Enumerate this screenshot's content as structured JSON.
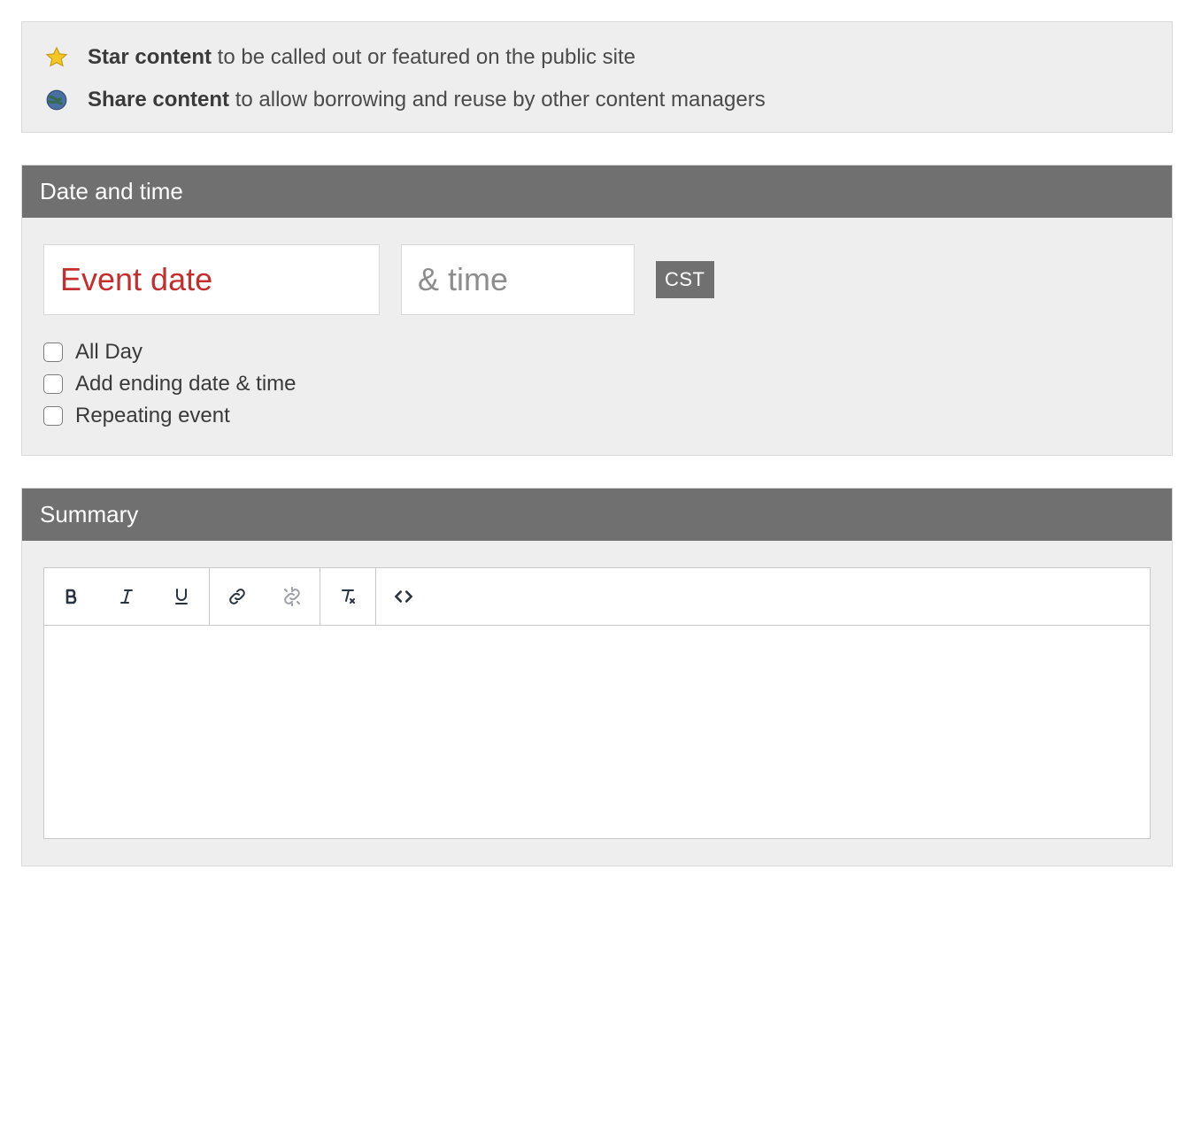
{
  "info": {
    "star_bold": "Star content",
    "star_rest": " to be called out or featured on the public site",
    "share_bold": "Share content",
    "share_rest": " to allow borrowing and reuse by other content managers"
  },
  "datetime_section": {
    "title": "Date and time",
    "date_placeholder": "Event date",
    "time_placeholder": "& time",
    "timezone": "CST",
    "all_day_label": "All Day",
    "add_end_label": "Add ending date & time",
    "repeating_label": "Repeating event"
  },
  "summary_section": {
    "title": "Summary"
  }
}
